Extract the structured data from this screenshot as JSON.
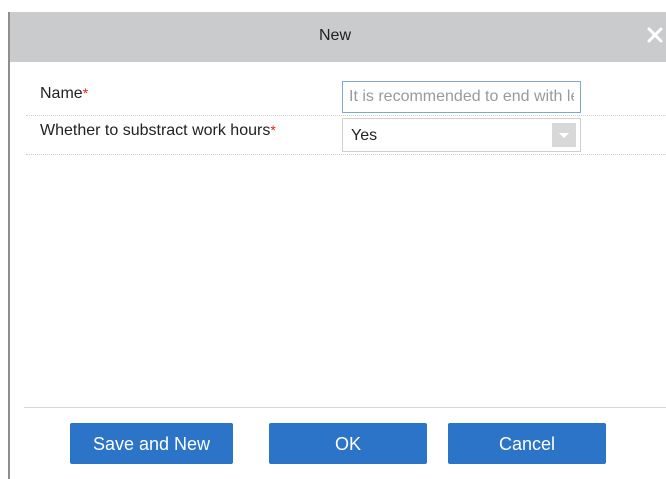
{
  "dialog": {
    "title": "New",
    "close_icon": "close-icon"
  },
  "form": {
    "name": {
      "label": "Name",
      "required_mark": "*",
      "value": "",
      "placeholder": "It is recommended to end with letters"
    },
    "subtract_work_hours": {
      "label": "Whether to substract work hours",
      "required_mark": "*",
      "selected": "Yes",
      "arrow_icon": "chevron-down-icon"
    }
  },
  "footer": {
    "save_and_new_label": "Save and New",
    "ok_label": "OK",
    "cancel_label": "Cancel"
  },
  "colors": {
    "title_bar": "#c9cbcd",
    "button": "#2b74c7",
    "required": "#e02020",
    "input_border_focus": "#7ea7d8"
  }
}
